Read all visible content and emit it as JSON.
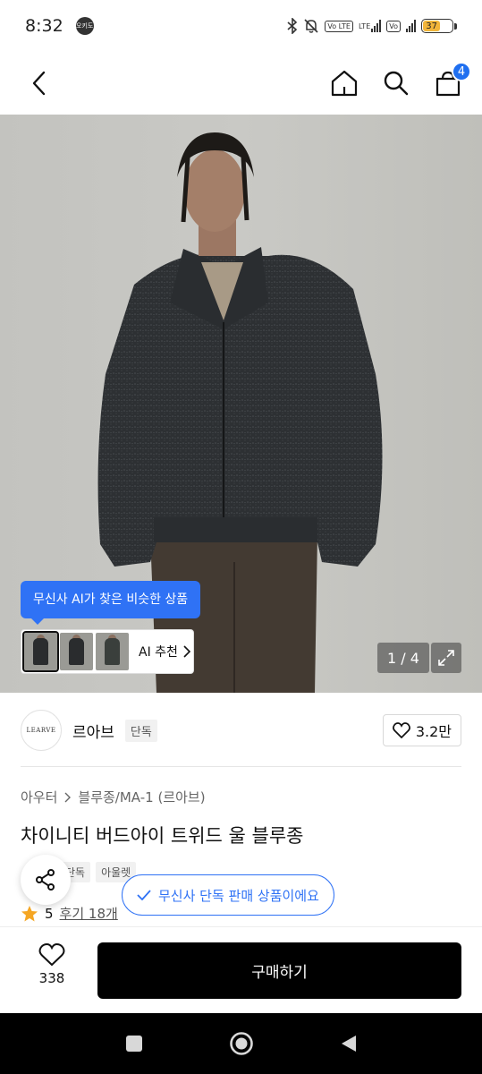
{
  "status_bar": {
    "time": "8:32",
    "app_icon_label": "오키도",
    "lte_label": "Vo LTE",
    "lte_label2": "LTE",
    "battery": "37"
  },
  "nav": {
    "cart_count": "4"
  },
  "hero": {
    "ai_tooltip": "무신사 AI가 찾은 비슷한 상품",
    "ai_recommend": "AI 추천",
    "page_counter": "1 / 4"
  },
  "brand": {
    "logo_text": "LEARVE",
    "name": "르아브",
    "tag": "단독",
    "likes": "3.2만"
  },
  "breadcrumb": [
    "아우터",
    "블루종/MA-1 (르아브)"
  ],
  "product": {
    "title": "차이니티 버드아이 트위드 울 블루종",
    "tags": [
      "단독",
      "아울렛"
    ],
    "rating": "5",
    "reviews": "후기 18개"
  },
  "exclusive_toast": "무신사 단독 판매 상품이에요",
  "bottom": {
    "wish_count": "338",
    "buy_label": "구매하기"
  }
}
